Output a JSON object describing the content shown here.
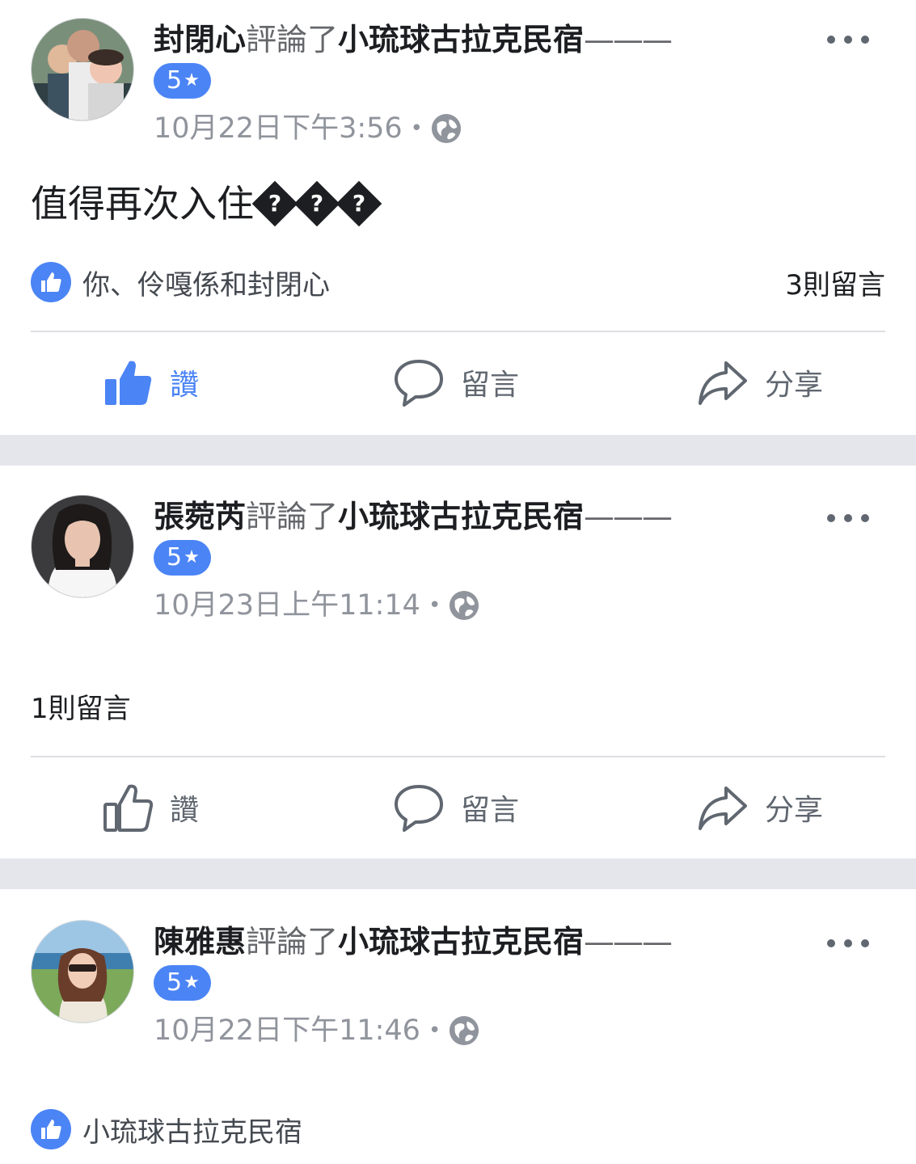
{
  "colors": {
    "accent": "#4b84f5",
    "separator": "#e4e6eb",
    "meta": "#90949c",
    "icon": "#606770"
  },
  "posts": [
    {
      "author": "封閉心",
      "verb": "評論了",
      "page": "小琉球古拉克民宿",
      "rating": "5",
      "star": "★",
      "time": "10月22日下午3:56",
      "dot": "•",
      "text": "值得再次入住",
      "text_glyphs": [
        "?",
        "?",
        "?"
      ],
      "reactions": "你、伶嘎係和封閉心",
      "comment_count": "3則留言",
      "actions": {
        "like": "讚",
        "comment": "留言",
        "share": "分享"
      },
      "liked": true
    },
    {
      "author": "張菀芮",
      "verb": "評論了",
      "page": "小琉球古拉克民宿",
      "rating": "5",
      "star": "★",
      "time": "10月23日上午11:14",
      "dot": "•",
      "comment_count": "1則留言",
      "actions": {
        "like": "讚",
        "comment": "留言",
        "share": "分享"
      },
      "liked": false
    },
    {
      "author": "陳雅惠",
      "verb": "評論了",
      "page": "小琉球古拉克民宿",
      "rating": "5",
      "star": "★",
      "time": "10月22日下午11:46",
      "dot": "•",
      "reactions": "小琉球古拉克民宿"
    }
  ],
  "header_dash": "———"
}
